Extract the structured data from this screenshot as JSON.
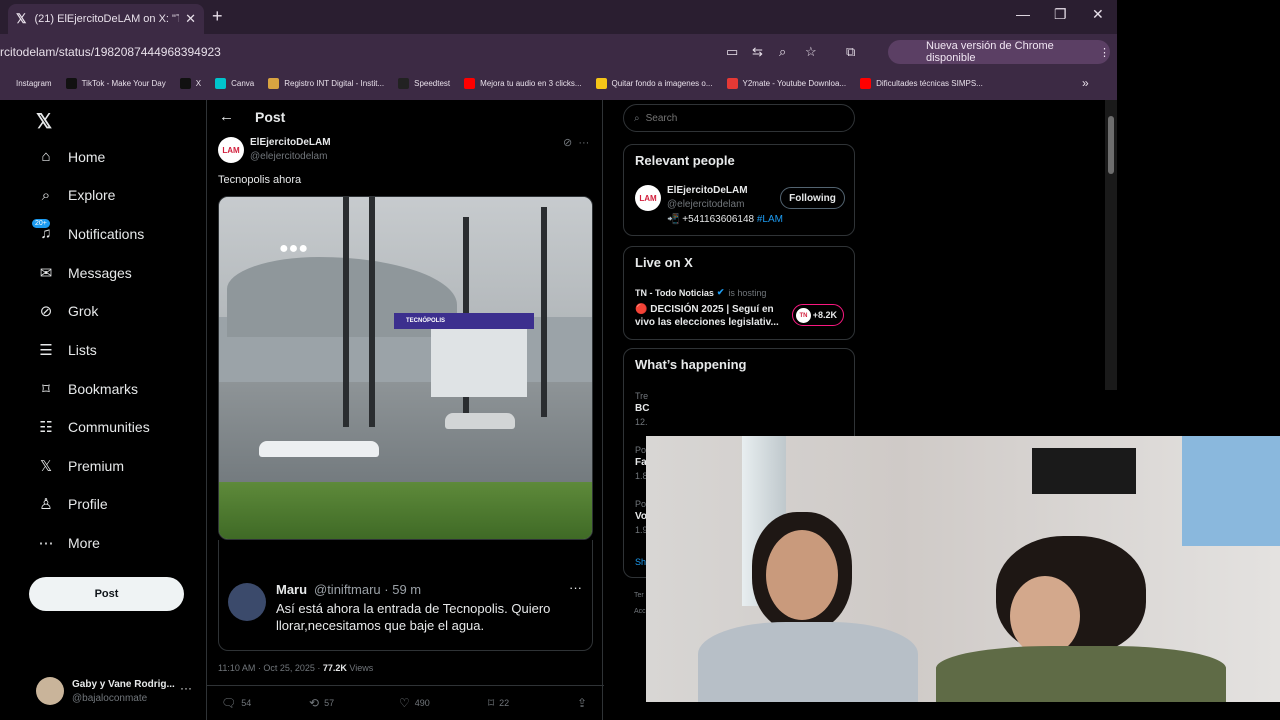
{
  "browser": {
    "tab_title": "(21) ElEjercitoDeLAM on X: \"Tecnopolis ah",
    "url": "rcitodelam/status/1982087444968394923",
    "update_label": "Nueva versión de Chrome disponible",
    "bookmarks": [
      {
        "label": "Instagram",
        "color": "#3c2a44"
      },
      {
        "label": "TikTok - Make Your Day",
        "color": "#111111"
      },
      {
        "label": "X",
        "color": "#111111"
      },
      {
        "label": "Canva",
        "color": "#00c4cc"
      },
      {
        "label": "Registro INT Digital - Instit...",
        "color": "#d9a441"
      },
      {
        "label": "Speedtest",
        "color": "#222222"
      },
      {
        "label": "Mejora tu audio en 3 clicks...",
        "color": "#ff0000"
      },
      {
        "label": "Quitar fondo a imagenes o...",
        "color": "#f5c518"
      },
      {
        "label": "Y2mate - Youtube Downloa...",
        "color": "#e53935"
      },
      {
        "label": "Dificultades técnicas SIMPS...",
        "color": "#ff0000"
      }
    ],
    "more_bookmarks": "»"
  },
  "sidebar": {
    "logo": "𝕏",
    "items": [
      {
        "label": "Home",
        "icon": "⌂"
      },
      {
        "label": "Explore",
        "icon": "⌕"
      },
      {
        "label": "Notifications",
        "icon": "♫",
        "badge": "20+"
      },
      {
        "label": "Messages",
        "icon": "✉"
      },
      {
        "label": "Grok",
        "icon": "⊘"
      },
      {
        "label": "Lists",
        "icon": "☰"
      },
      {
        "label": "Bookmarks",
        "icon": "⌑"
      },
      {
        "label": "Communities",
        "icon": "☷"
      },
      {
        "label": "Premium",
        "icon": "𝕏"
      },
      {
        "label": "Profile",
        "icon": "♙"
      },
      {
        "label": "More",
        "icon": "⋯"
      }
    ],
    "post_button": "Post",
    "account_name": "Gaby y Vane Rodrig...",
    "account_handle": "@bajaloconmate",
    "account_more": "···"
  },
  "main": {
    "header_title": "Post",
    "author_name": "ElEjercitoDeLAM",
    "author_handle": "@elejercitodelam",
    "avatar_text": "LAM",
    "tweet_text": "Tecnopolis ahora",
    "media_sign": "TECNÓPOLIS",
    "quote": {
      "name": "Maru",
      "meta": "@tiniftmaru · 59 m",
      "text": "Así está ahora la entrada de Tecnopolis. Quiero llorar,necesitamos que baje el agua."
    },
    "timestamp": "11:10 AM · Oct 25, 2025 · ",
    "views_count": "77.2K",
    "views_label": " Views",
    "stats": {
      "replies": "54",
      "reposts": "57",
      "likes": "490",
      "bookmarks": "22"
    }
  },
  "right": {
    "search_placeholder": "Search",
    "relevant_title": "Relevant people",
    "relevant_name": "ElEjercitoDeLAM",
    "relevant_handle": "@elejercitodelam",
    "relevant_bio": "📲 +541163606148 ",
    "relevant_tag": "#LAM",
    "follow_label": "Following",
    "live_title": "Live on X",
    "live_host": "TN - Todo Noticias",
    "live_hosting": "is hosting",
    "live_event": "🔴 DECISIÓN 2025 | Seguí en vivo las elecciones legislativ...",
    "live_count": "+8.2K",
    "happening_title": "What’s happening",
    "trends": [
      {
        "meta": "Tre",
        "title": "BC",
        "sub": "12."
      },
      {
        "meta": "Po",
        "title": "Fa",
        "sub": "1.8"
      },
      {
        "meta": "Po",
        "title": "Vo",
        "sub": "1.9"
      }
    ],
    "show_more": "Sh",
    "footer_terms": "Ter",
    "footer_acc": "Acc"
  },
  "colors": {
    "accent": "#1d9bf0",
    "live": "#f91880",
    "chrome_bg": "#3c2a44"
  }
}
